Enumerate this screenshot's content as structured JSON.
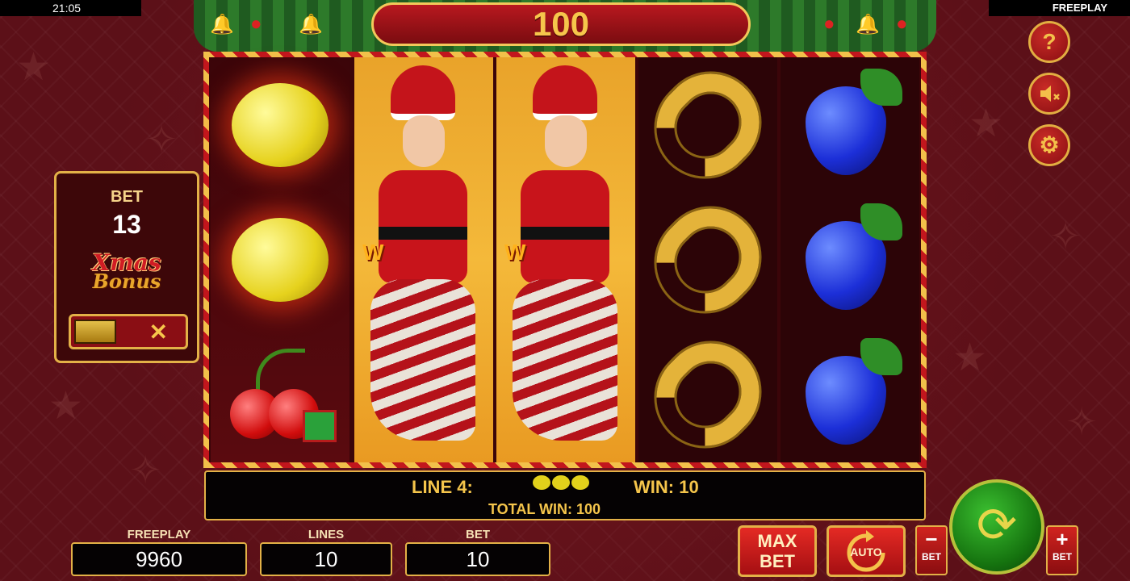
{
  "status_bar": {
    "time": "21:05",
    "mode": "FREEPLAY"
  },
  "top_win": "100",
  "bet_panel": {
    "label": "BET",
    "value": "13",
    "logo_line1": "Xmas",
    "logo_line2": "Bonus",
    "toggle_off": "✕"
  },
  "side_buttons": {
    "help_icon": "?",
    "sound_icon": "speaker-muted",
    "settings_icon": "gear"
  },
  "reels": [
    [
      "lemon",
      "lemon",
      "cherry"
    ],
    [
      "santa-wild"
    ],
    [
      "santa-wild"
    ],
    [
      "horseshoe",
      "horseshoe",
      "horseshoe"
    ],
    [
      "grapes",
      "grapes",
      "grapes"
    ]
  ],
  "wild_badge": "W",
  "win_info": {
    "line": "LINE 4:",
    "win": "WIN: 10",
    "total": "TOTAL WIN: 100"
  },
  "bottom": {
    "freeplay_label": "FREEPLAY",
    "freeplay_value": "9960",
    "lines_label": "LINES",
    "lines_value": "10",
    "bet_label": "BET",
    "bet_value": "10",
    "max_bet_line1": "MAX",
    "max_bet_line2": "BET",
    "auto_label": "AUTO",
    "bet_minus_symbol": "−",
    "bet_minus_label": "BET",
    "bet_plus_symbol": "+",
    "bet_plus_label": "BET"
  },
  "colors": {
    "accent_gold": "#f5c54b",
    "frame_red": "#c2161d",
    "spin_green": "#15730f"
  }
}
